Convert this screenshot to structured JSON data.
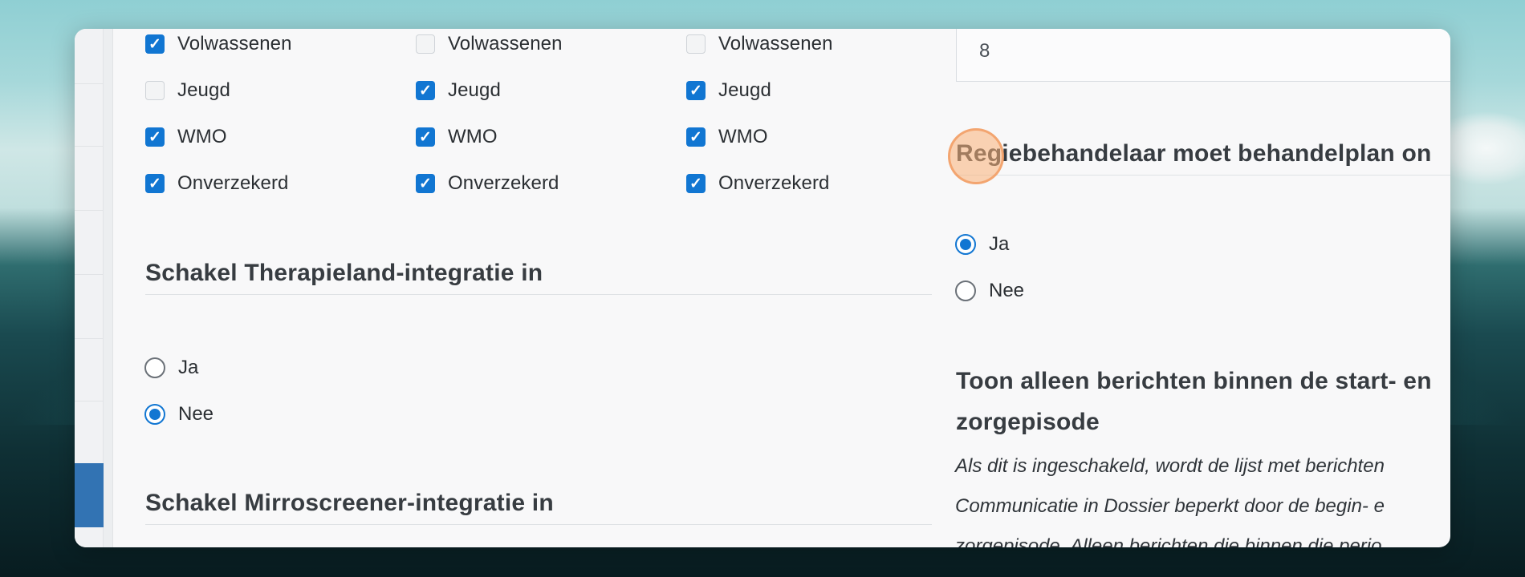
{
  "checkbox_columns": [
    {
      "items": [
        {
          "label": "Volwassenen",
          "checked": true
        },
        {
          "label": "Jeugd",
          "checked": false
        },
        {
          "label": "WMO",
          "checked": true
        },
        {
          "label": "Onverzekerd",
          "checked": true
        }
      ]
    },
    {
      "items": [
        {
          "label": "Volwassenen",
          "checked": false
        },
        {
          "label": "Jeugd",
          "checked": true
        },
        {
          "label": "WMO",
          "checked": true
        },
        {
          "label": "Onverzekerd",
          "checked": true
        }
      ]
    },
    {
      "items": [
        {
          "label": "Volwassenen",
          "checked": false
        },
        {
          "label": "Jeugd",
          "checked": true
        },
        {
          "label": "WMO",
          "checked": true
        },
        {
          "label": "Onverzekerd",
          "checked": true
        }
      ]
    }
  ],
  "therapieland": {
    "title": "Schakel Therapieland-integratie in",
    "options": {
      "yes": "Ja",
      "no": "Nee"
    },
    "selected": "no"
  },
  "mirroscreener": {
    "title": "Schakel Mirroscreener-integratie in"
  },
  "number_field": {
    "value": "8"
  },
  "regiebehandelaar": {
    "title": "Regiebehandelaar moet behandelplan on",
    "options": {
      "yes": "Ja",
      "no": "Nee"
    },
    "selected": "yes"
  },
  "berichten": {
    "title_line1": "Toon alleen berichten binnen de start- en",
    "title_line2": "zorgepisode",
    "description_line1": "Als dit is ingeschakeld, wordt de lijst met berichten",
    "description_line2": "Communicatie in Dossier beperkt door de begin- e",
    "description_line3": "zorgepisode. Alleen berichten die binnen die perio"
  },
  "colors": {
    "accent": "#1176d2",
    "sidebar_active": "#3273b3",
    "click_marker": "#fab078"
  },
  "icons": {
    "check": "check-icon"
  }
}
